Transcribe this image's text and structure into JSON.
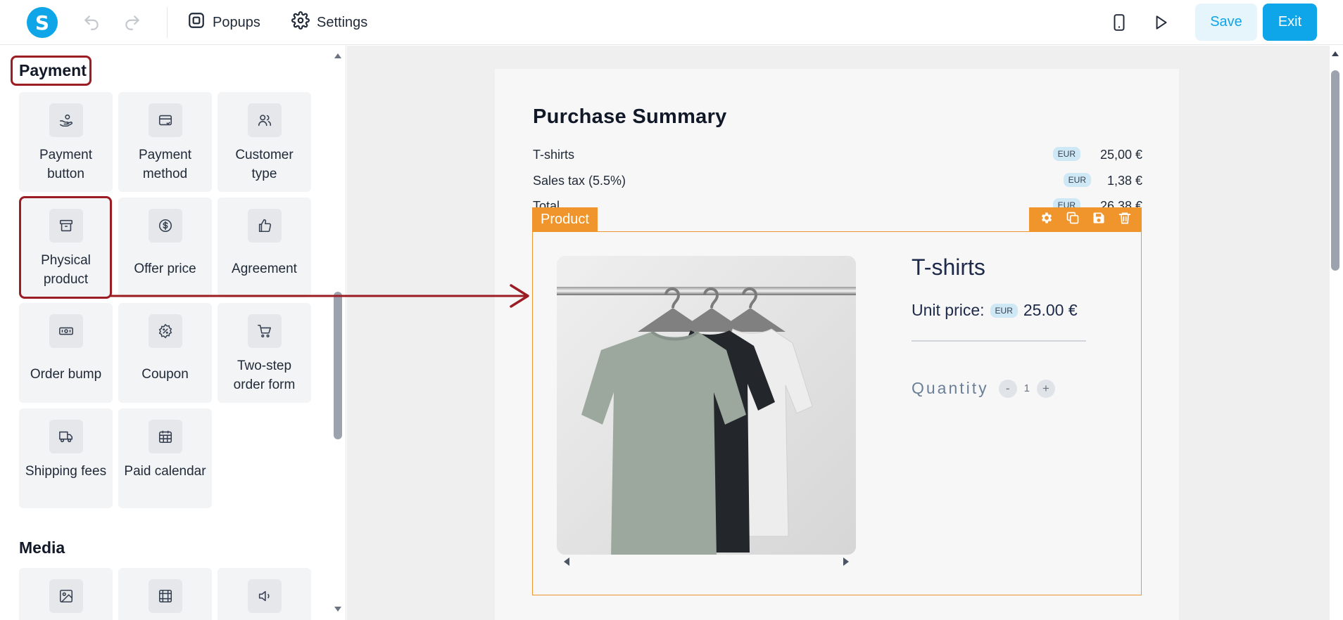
{
  "topbar": {
    "logo_letter": "S",
    "popups_label": "Popups",
    "settings_label": "Settings",
    "save_label": "Save",
    "exit_label": "Exit",
    "accent": "#0ea5e9"
  },
  "sidebar": {
    "payment_title": "Payment",
    "media_title": "Media",
    "payment_tiles": [
      {
        "label": "Payment button",
        "icon": "hand-coin-icon"
      },
      {
        "label": "Payment method",
        "icon": "credit-card-icon"
      },
      {
        "label": "Customer type",
        "icon": "users-icon"
      },
      {
        "label": "Physical product",
        "icon": "archive-box-icon"
      },
      {
        "label": "Offer price",
        "icon": "dollar-circle-icon"
      },
      {
        "label": "Agreement",
        "icon": "thumbs-up-icon"
      },
      {
        "label": "Order bump",
        "icon": "banknote-icon"
      },
      {
        "label": "Coupon",
        "icon": "percent-badge-icon"
      },
      {
        "label": "Two-step order form",
        "icon": "cart-icon"
      },
      {
        "label": "Shipping fees",
        "icon": "truck-icon"
      },
      {
        "label": "Paid calendar",
        "icon": "calendar-icon"
      }
    ],
    "media_tiles": [
      {
        "icon": "image-icon"
      },
      {
        "icon": "video-frame-icon"
      },
      {
        "icon": "speaker-icon"
      }
    ]
  },
  "summary": {
    "title": "Purchase Summary",
    "currency_badge": "EUR",
    "rows": [
      {
        "name": "T-shirts",
        "amount": "25,00 €"
      },
      {
        "name": "Sales tax (5.5%)",
        "amount": "1,38 €"
      },
      {
        "name": "Total",
        "amount": "26,38 €"
      }
    ]
  },
  "product": {
    "tag": "Product",
    "title": "T-shirts",
    "unit_price_label": "Unit price:",
    "currency_badge": "EUR",
    "unit_price": "25.00 €",
    "quantity_label": "Quantity",
    "quantity_value": "1",
    "minus": "-",
    "plus": "+",
    "highlight_color": "#f0952b"
  },
  "annotation_color": "#9b1c23"
}
